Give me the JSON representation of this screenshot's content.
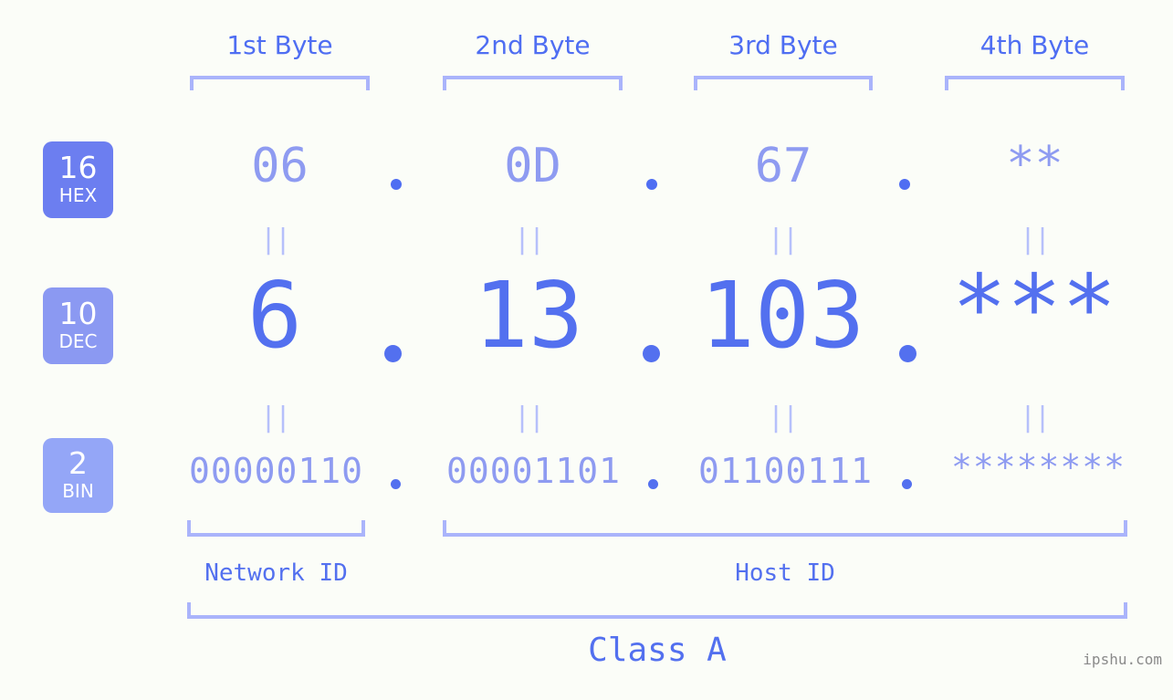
{
  "meta": {
    "background_color": "#fbfdf8",
    "accent_strong": "#5370ef",
    "accent_light": "#8e9bf1",
    "accent_bracket": "#aab4fb",
    "watermark_color": "#8a8a8a"
  },
  "byte_headers": [
    {
      "label": "1st Byte"
    },
    {
      "label": "2nd Byte"
    },
    {
      "label": "3rd Byte"
    },
    {
      "label": "4th Byte"
    }
  ],
  "bases": [
    {
      "number": "16",
      "name": "HEX",
      "color": "#6c7ef0"
    },
    {
      "number": "10",
      "name": "DEC",
      "color": "#8b99f2"
    },
    {
      "number": "2",
      "name": "BIN",
      "color": "#94a6f7"
    }
  ],
  "rows": {
    "hex": {
      "values": [
        "06",
        "0D",
        "67",
        "**"
      ],
      "separator": "."
    },
    "dec": {
      "values": [
        "6",
        "13",
        "103",
        "***"
      ],
      "separator": "."
    },
    "bin": {
      "values": [
        "00000110",
        "00001101",
        "01100111",
        "********"
      ],
      "separator": "."
    }
  },
  "equals_mark": "||",
  "segments": [
    {
      "label": "Network ID"
    },
    {
      "label": "Host ID"
    }
  ],
  "class": {
    "label": "Class A"
  },
  "watermark": {
    "text": "ipshu.com"
  }
}
